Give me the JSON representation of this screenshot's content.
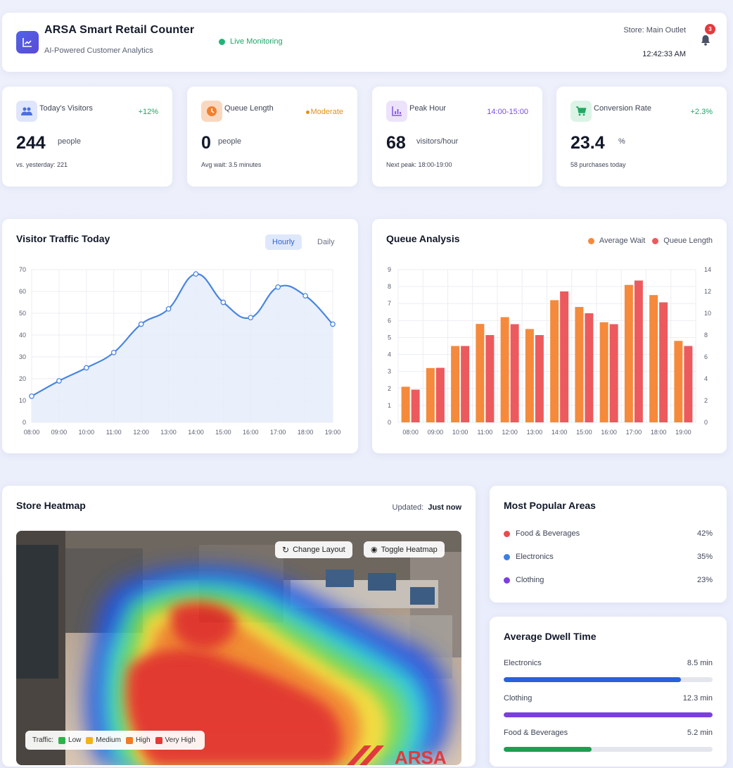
{
  "header": {
    "title": "ARSA Smart Retail Counter",
    "subtitle": "AI-Powered Customer Analytics",
    "live_label": "Live Monitoring",
    "store": "Store: Main Outlet",
    "time": "12:42:33 AM",
    "notification_count": "3"
  },
  "stats": [
    {
      "label": "Today's Visitors",
      "tag": "+12%",
      "tag_color": "#1ea56a",
      "value": "244",
      "unit": "people",
      "footer": "vs. yesterday: 221",
      "icon": "users-icon",
      "icon_bg": "#dfe6fb",
      "icon_color": "#4b6fe0"
    },
    {
      "label": "Queue Length",
      "tag": "Moderate",
      "tag_color": "#e0911a",
      "value": "0",
      "unit": "people",
      "footer": "Avg wait: 3.5 minutes",
      "icon": "clock-icon",
      "icon_bg": "#f9d8bf",
      "icon_color": "#f08030"
    },
    {
      "label": "Peak Hour",
      "tag": "14:00-15:00",
      "tag_color": "#7a4fe0",
      "value": "68",
      "unit": "visitors/hour",
      "footer": "Next peak: 18:00-19:00",
      "icon": "chart-bars-icon",
      "icon_bg": "#ece3fb",
      "icon_color": "#8a5be0"
    },
    {
      "label": "Conversion Rate",
      "tag": "+2.3%",
      "tag_color": "#1ea56a",
      "value": "23.4",
      "unit": "%",
      "footer": "58 purchases today",
      "icon": "cart-icon",
      "icon_bg": "#dcf4e6",
      "icon_color": "#22a862"
    }
  ],
  "traffic": {
    "title": "Visitor Traffic Today",
    "tabs": [
      "Hourly",
      "Daily"
    ],
    "active_tab": "Hourly"
  },
  "queue": {
    "title": "Queue Analysis",
    "legend": [
      {
        "name": "Average Wait",
        "color": "#f58a3c"
      },
      {
        "name": "Queue Length",
        "color": "#ec5a5e"
      }
    ]
  },
  "chart_data": [
    {
      "type": "area",
      "title": "Visitor Traffic Today",
      "x": [
        "08:00",
        "09:00",
        "10:00",
        "11:00",
        "12:00",
        "13:00",
        "14:00",
        "15:00",
        "16:00",
        "17:00",
        "18:00",
        "19:00"
      ],
      "values": [
        12,
        19,
        25,
        32,
        45,
        52,
        68,
        55,
        48,
        62,
        58,
        45
      ],
      "ylim": [
        0,
        70
      ],
      "yticks": [
        0,
        10,
        20,
        30,
        40,
        50,
        60,
        70
      ],
      "color": "#4a86e0",
      "grid": true
    },
    {
      "type": "bar",
      "title": "Queue Analysis",
      "categories": [
        "08:00",
        "09:00",
        "10:00",
        "11:00",
        "12:00",
        "13:00",
        "14:00",
        "15:00",
        "16:00",
        "17:00",
        "18:00",
        "19:00"
      ],
      "series": [
        {
          "name": "Average Wait",
          "axis": "left",
          "color": "#f58a3c",
          "values": [
            2.1,
            3.2,
            4.5,
            5.8,
            6.2,
            5.5,
            7.2,
            6.8,
            5.9,
            8.1,
            7.5,
            4.8
          ]
        },
        {
          "name": "Queue Length",
          "axis": "right",
          "color": "#ec5a5e",
          "values": [
            3,
            5,
            7,
            8,
            9,
            8,
            12,
            10,
            9,
            13,
            11,
            7
          ]
        }
      ],
      "ylim_left": [
        0,
        9
      ],
      "yticks_left": [
        0,
        1,
        2,
        3,
        4,
        5,
        6,
        7,
        8,
        9
      ],
      "ylim_right": [
        0,
        14
      ],
      "yticks_right": [
        0,
        2,
        4,
        6,
        8,
        10,
        12,
        14
      ],
      "legend": "top-right",
      "grid": true
    }
  ],
  "heatmap": {
    "title": "Store Heatmap",
    "updated_label": "Updated:",
    "updated_value": "Just now",
    "change_layout": "Change Layout",
    "toggle_heatmap": "Toggle Heatmap",
    "legend_title": "Traffic:",
    "legend": [
      {
        "name": "Low",
        "color": "#2bb34a"
      },
      {
        "name": "Medium",
        "color": "#f2b21c"
      },
      {
        "name": "High",
        "color": "#f27a22"
      },
      {
        "name": "Very High",
        "color": "#e53935"
      }
    ],
    "watermark": "ARSA"
  },
  "popular": {
    "title": "Most Popular Areas",
    "items": [
      {
        "name": "Food & Beverages",
        "value": "42%",
        "color": "#e74c4c"
      },
      {
        "name": "Electronics",
        "value": "35%",
        "color": "#3d7fe0"
      },
      {
        "name": "Clothing",
        "value": "23%",
        "color": "#7b3fe0"
      }
    ]
  },
  "dwell": {
    "title": "Average Dwell Time",
    "items": [
      {
        "name": "Electronics",
        "value": "8.5 min",
        "fraction": 0.85,
        "color": "#2b5fdc"
      },
      {
        "name": "Clothing",
        "value": "12.3 min",
        "fraction": 1.0,
        "color": "#7b3fe0"
      },
      {
        "name": "Food & Beverages",
        "value": "5.2 min",
        "fraction": 0.42,
        "color": "#1e9e50"
      }
    ]
  }
}
